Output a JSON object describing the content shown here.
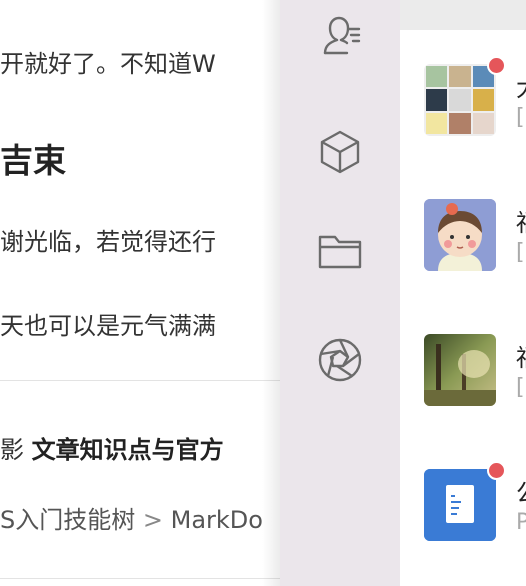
{
  "article": {
    "line1": "开就好了。不知道W",
    "heading": "吉束",
    "line3": "谢光临，若觉得还行",
    "line4": "天也可以是元气满满",
    "line5_prefix": "影",
    "line5_bold": "文章知识点与官方",
    "line6_a": "S入门技能树",
    "line6_chev": ">",
    "line6_b": "MarkDo"
  },
  "sidebar": {
    "icons": [
      "contacts-icon",
      "box-icon",
      "folder-icon",
      "aperture-icon"
    ]
  },
  "chats": [
    {
      "name": "大",
      "sub": "[",
      "badge": true,
      "avatar": "group-grid"
    },
    {
      "name": "福",
      "sub": "[",
      "badge": false,
      "avatar": "cartoon-boy"
    },
    {
      "name": "福",
      "sub": "[",
      "badge": false,
      "avatar": "forest-photo"
    },
    {
      "name": "公",
      "sub": "P",
      "badge": true,
      "avatar": "document-icon"
    }
  ],
  "colors": {
    "sidebar_bg": "#ebe6eb",
    "badge": "#e5565a",
    "doc_blue": "#3a7bd5"
  }
}
